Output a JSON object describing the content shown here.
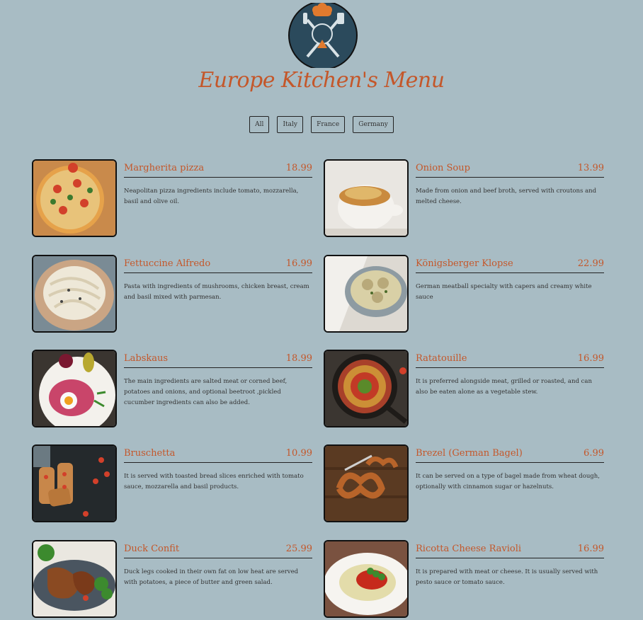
{
  "header": {
    "title": "Europe Kitchen's Menu"
  },
  "filters": [
    "All",
    "Italy",
    "France",
    "Germany"
  ],
  "items": [
    {
      "name": "Margherita pizza",
      "price": "18.99",
      "desc": "Neapolitan pizza ingredients include tomato, mozzarella, basil and olive oil."
    },
    {
      "name": "Onion Soup",
      "price": "13.99",
      "desc": "Made from onion and beef broth, served with croutons and melted cheese."
    },
    {
      "name": "Fettuccine Alfredo",
      "price": "16.99",
      "desc": "Pasta with ingredients of mushrooms, chicken breast, cream and basil mixed with parmesan."
    },
    {
      "name": "Königsberger Klopse",
      "price": "22.99",
      "desc": "German meatball specialty with capers and creamy white sauce"
    },
    {
      "name": "Labskaus",
      "price": "18.99",
      "desc": "The main ingredients are salted meat or corned beef, potatoes and onions, and optional beetroot ,pickled cucumber ingredients can also be added."
    },
    {
      "name": "Ratatouille",
      "price": "16.99",
      "desc": "It is preferred alongside meat, grilled or roasted, and can also be eaten alone as a vegetable stew."
    },
    {
      "name": "Bruschetta",
      "price": "10.99",
      "desc": "It is served with toasted bread slices enriched with tomato sauce, mozzarella and basil products."
    },
    {
      "name": "Brezel (German Bagel)",
      "price": "6.99",
      "desc": "It can be served on a type of bagel made from wheat dough, optionally with cinnamon sugar or hazelnuts."
    },
    {
      "name": "Duck Confit",
      "price": "25.99",
      "desc": "Duck legs cooked in their own fat on low heat are served with potatoes, a piece of butter and green salad."
    },
    {
      "name": "Ricotta Cheese Ravioli",
      "price": "16.99",
      "desc": "It is prepared with meat or cheese. It is usually served with pesto sauce or tomato sauce."
    }
  ]
}
